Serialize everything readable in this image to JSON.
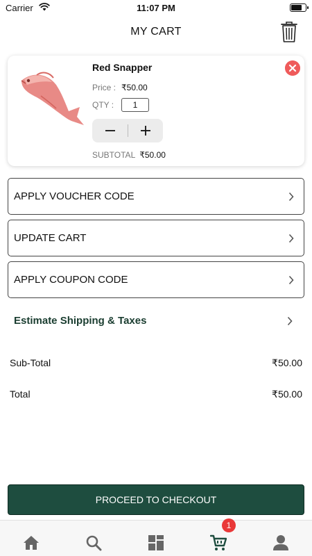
{
  "status_bar": {
    "carrier": "Carrier",
    "time": "11:07 PM",
    "battery_level": 0.8
  },
  "header": {
    "title": "MY CART",
    "trash_icon": "trash-icon"
  },
  "cart_item": {
    "name": "Red Snapper",
    "price_label": "Price :",
    "price": "₹50.00",
    "qty_label": "QTY :",
    "qty": "1",
    "subtotal_label": "SUBTOTAL",
    "subtotal": "₹50.00",
    "remove_icon": "close-icon",
    "image": "red-snapper-fish-image"
  },
  "actions": [
    {
      "label": "APPLY VOUCHER CODE"
    },
    {
      "label": "UPDATE CART"
    },
    {
      "label": "APPLY COUPON CODE"
    }
  ],
  "shipping": {
    "label": "Estimate Shipping & Taxes"
  },
  "totals": {
    "subtotal_label": "Sub-Total",
    "subtotal_value": "₹50.00",
    "total_label": "Total",
    "total_value": "₹50.00"
  },
  "checkout": {
    "label": "PROCEED TO CHECKOUT"
  },
  "tab_bar": {
    "tabs": [
      {
        "icon": "home-icon"
      },
      {
        "icon": "search-icon"
      },
      {
        "icon": "categories-icon"
      },
      {
        "icon": "cart-icon",
        "badge": "1"
      },
      {
        "icon": "profile-icon"
      }
    ]
  },
  "colors": {
    "primary": "#1e4d3f",
    "shipping_text": "#1a3d30",
    "remove": "#ef5b5b",
    "badge": "#e93838",
    "cart_tab_active": "#1e4d3f",
    "tab_inactive": "#666666"
  }
}
